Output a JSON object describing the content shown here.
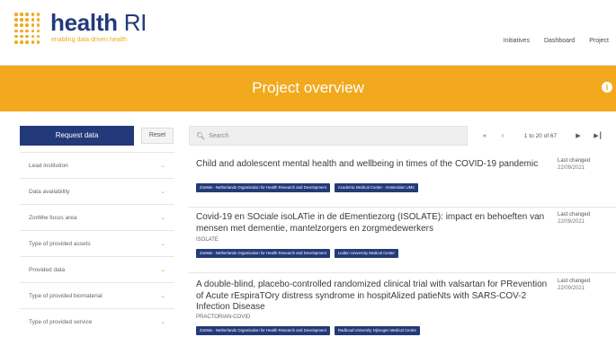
{
  "brand": {
    "name_part1": "health",
    "name_part2": " RI",
    "tagline": "enabling data driven health",
    "color": "#233a7a",
    "accent": "#f2a91e"
  },
  "topnav": {
    "items": [
      "Initiatives",
      "Dashboard",
      "Project"
    ]
  },
  "banner": {
    "title": "Project overview",
    "help_icon": "info-icon"
  },
  "sidebar": {
    "request_label": "Request data",
    "reset_label": "Reset",
    "filters": [
      "Lead institution",
      "Data availability",
      "ZonMw focus area",
      "Type of provided assets",
      "Provided data",
      "Type of provided biomaterial",
      "Type of provided service"
    ]
  },
  "toolbar": {
    "search_placeholder": "Search",
    "first_icon": "first-page-icon",
    "prev_icon": "prev-page-icon",
    "count": "1 to 20 of 67",
    "next_icon": "next-page-icon",
    "last_icon": "last-page-icon"
  },
  "results": [
    {
      "title": "Child and adolescent mental health and wellbeing in times of the COVID-19 pandemic",
      "acronym": "",
      "tags": [
        "ZonMw - Netherlands Organisation for Health Research and Development",
        "Academic Medical Center - Amsterdam UMC"
      ],
      "changed_label": "Last changed",
      "changed_date": "22/09/2021"
    },
    {
      "title": "Covid-19 en SOciale isoLATie in de dEmentiezorg (ISOLATE): impact en behoeften van mensen met dementie, mantelzorgers en zorgmedewerkers",
      "acronym": "ISOLATE",
      "tags": [
        "ZonMw - Netherlands Organisation for Health Research and Development",
        "Leiden University Medical Center"
      ],
      "changed_label": "Last changed",
      "changed_date": "22/09/2021"
    },
    {
      "title": "A double-blind, placebo-controlled randomized clinical trial with valsartan for PRevention of Acute rEspiraTOry distress syndrome in hospitAlized patieNts with SARS-COV-2 Infection Disease",
      "acronym": "PRACTORIAN-COVID",
      "tags": [
        "ZonMw - Netherlands Organisation for Health Research and Development",
        "Radboud University Nijmegen Medical Centre"
      ],
      "changed_label": "Last changed",
      "changed_date": "22/09/2021"
    }
  ]
}
